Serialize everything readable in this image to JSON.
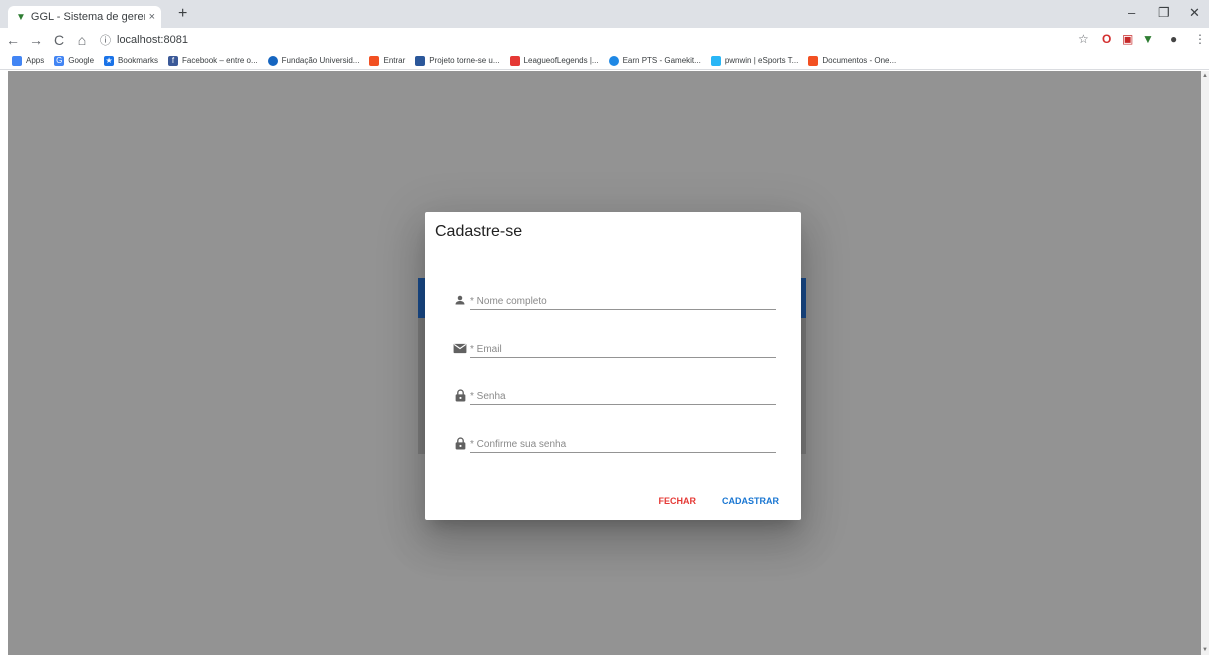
{
  "browser": {
    "tab_title": "GGL - Sistema de gerenciament",
    "tab_close": "×",
    "new_tab": "+",
    "url": "localhost:8081",
    "nav": {
      "back": "←",
      "forward": "→",
      "reload": "C",
      "home": "⌂",
      "info": "ⓘ"
    },
    "window": {
      "minimize": "–",
      "restore": "❐",
      "close": "✕"
    },
    "star": "☆"
  },
  "bookmarks": [
    {
      "label": "Apps",
      "color": "#4285f4"
    },
    {
      "label": "Google",
      "color": "#4285f4"
    },
    {
      "label": "Bookmarks",
      "color": "#1a73e8"
    },
    {
      "label": "Facebook – entre o...",
      "color": "#3b5998"
    },
    {
      "label": "Fundação Universid...",
      "color": "#1565c0"
    },
    {
      "label": "Entrar",
      "color": "#f25022"
    },
    {
      "label": "Projeto torne-se u...",
      "color": "#2b579a"
    },
    {
      "label": "LeagueofLegends |...",
      "color": "#e53935"
    },
    {
      "label": "Earn PTS - Gamekit...",
      "color": "#1e88e5"
    },
    {
      "label": "pwnwin | eSports T...",
      "color": "#29b6f6"
    },
    {
      "label": "Documentos - One...",
      "color": "#f25022"
    }
  ],
  "dialog": {
    "title": "Cadastre-se",
    "fields": [
      {
        "placeholder": "* Nome completo",
        "icon": "person-icon"
      },
      {
        "placeholder": "* Email",
        "icon": "email-icon"
      },
      {
        "placeholder": "* Senha",
        "icon": "lock-icon"
      },
      {
        "placeholder": "* Confirme sua senha",
        "icon": "lock-icon"
      }
    ],
    "close_label": "FECHAR",
    "submit_label": "CADASTRAR"
  },
  "colors": {
    "overlay": "#939393",
    "primary": "#1976d2",
    "danger": "#e53935",
    "header_blue": "#1a4c8c"
  }
}
